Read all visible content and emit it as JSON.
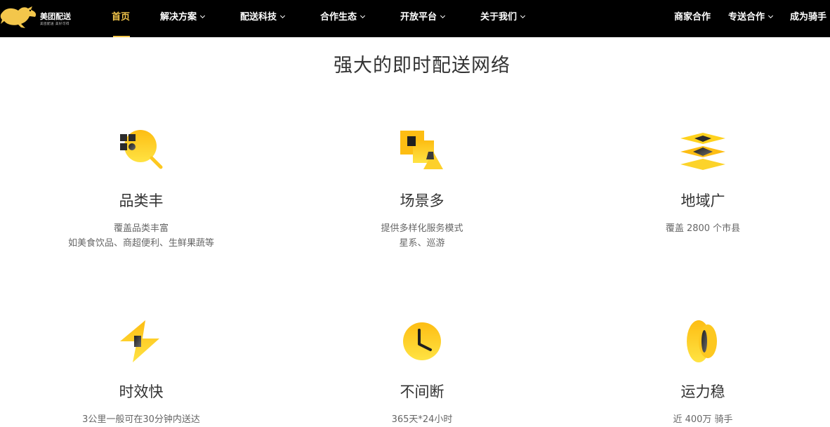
{
  "logo": {
    "brand_text": "美团配送",
    "slogan": "美团配送 美好可得"
  },
  "nav": {
    "items": [
      {
        "label": "首页",
        "active": true,
        "has_dropdown": false
      },
      {
        "label": "解决方案",
        "active": false,
        "has_dropdown": true
      },
      {
        "label": "配送科技",
        "active": false,
        "has_dropdown": true
      },
      {
        "label": "合作生态",
        "active": false,
        "has_dropdown": true
      },
      {
        "label": "开放平台",
        "active": false,
        "has_dropdown": true
      },
      {
        "label": "关于我们",
        "active": false,
        "has_dropdown": true
      }
    ],
    "right": [
      {
        "label": "商家合作",
        "has_dropdown": false
      },
      {
        "label": "专送合作",
        "has_dropdown": true
      },
      {
        "label": "成为骑手",
        "has_dropdown": false
      }
    ]
  },
  "section": {
    "title": "强大的即时配送网络"
  },
  "features": [
    {
      "icon": "magnifier-icon",
      "title": "品类丰",
      "desc": [
        "覆盖品类丰富",
        "如美食饮品、商超便利、生鲜果蔬等"
      ]
    },
    {
      "icon": "shapes-icon",
      "title": "场景多",
      "desc": [
        "提供多样化服务模式",
        "星系、巡游"
      ]
    },
    {
      "icon": "layers-icon",
      "title": "地域广",
      "desc": [
        "覆盖 2800 个市县"
      ]
    },
    {
      "icon": "lightning-icon",
      "title": "时效快",
      "desc": [
        "3公里一般可在30分钟内送达"
      ]
    },
    {
      "icon": "clock-icon",
      "title": "不间断",
      "desc": [
        "365天*24小时"
      ]
    },
    {
      "icon": "coin-icon",
      "title": "运力稳",
      "desc": [
        "近 400万 骑手"
      ]
    }
  ],
  "colors": {
    "accent": "#f3c64b",
    "icon_yellow": "#ffd21e",
    "nav_bg": "#000000"
  }
}
